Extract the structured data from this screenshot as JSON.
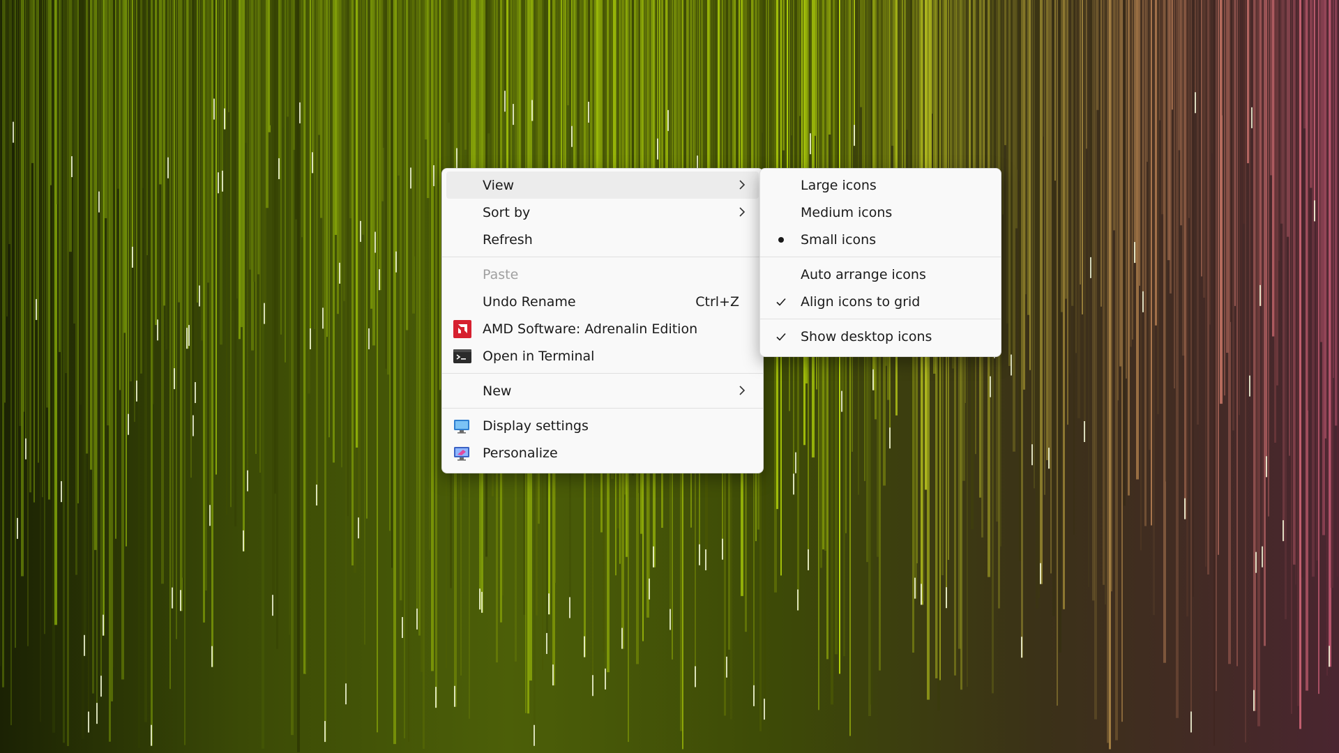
{
  "context_menu": {
    "items": [
      {
        "label": "View",
        "has_submenu": true,
        "highlighted": true
      },
      {
        "label": "Sort by",
        "has_submenu": true
      },
      {
        "label": "Refresh"
      },
      {
        "label": "Paste",
        "disabled": true
      },
      {
        "label": "Undo Rename",
        "shortcut": "Ctrl+Z"
      },
      {
        "label": "AMD Software: Adrenalin Edition",
        "icon": "amd-icon"
      },
      {
        "label": "Open in Terminal",
        "icon": "terminal-icon"
      },
      {
        "label": "New",
        "has_submenu": true
      },
      {
        "label": "Display settings",
        "icon": "display-icon"
      },
      {
        "label": "Personalize",
        "icon": "personalize-icon"
      }
    ]
  },
  "view_submenu": {
    "items": [
      {
        "label": "Large icons"
      },
      {
        "label": "Medium icons"
      },
      {
        "label": "Small icons",
        "mark": "bullet"
      },
      {
        "label": "Auto arrange icons"
      },
      {
        "label": "Align icons to grid",
        "mark": "check"
      },
      {
        "label": "Show desktop icons",
        "mark": "check"
      }
    ]
  },
  "colors": {
    "menu_background": "#f9f9f9",
    "highlight": "#ececec",
    "disabled_text": "#a0a0a0",
    "amd_red": "#d6202f"
  }
}
